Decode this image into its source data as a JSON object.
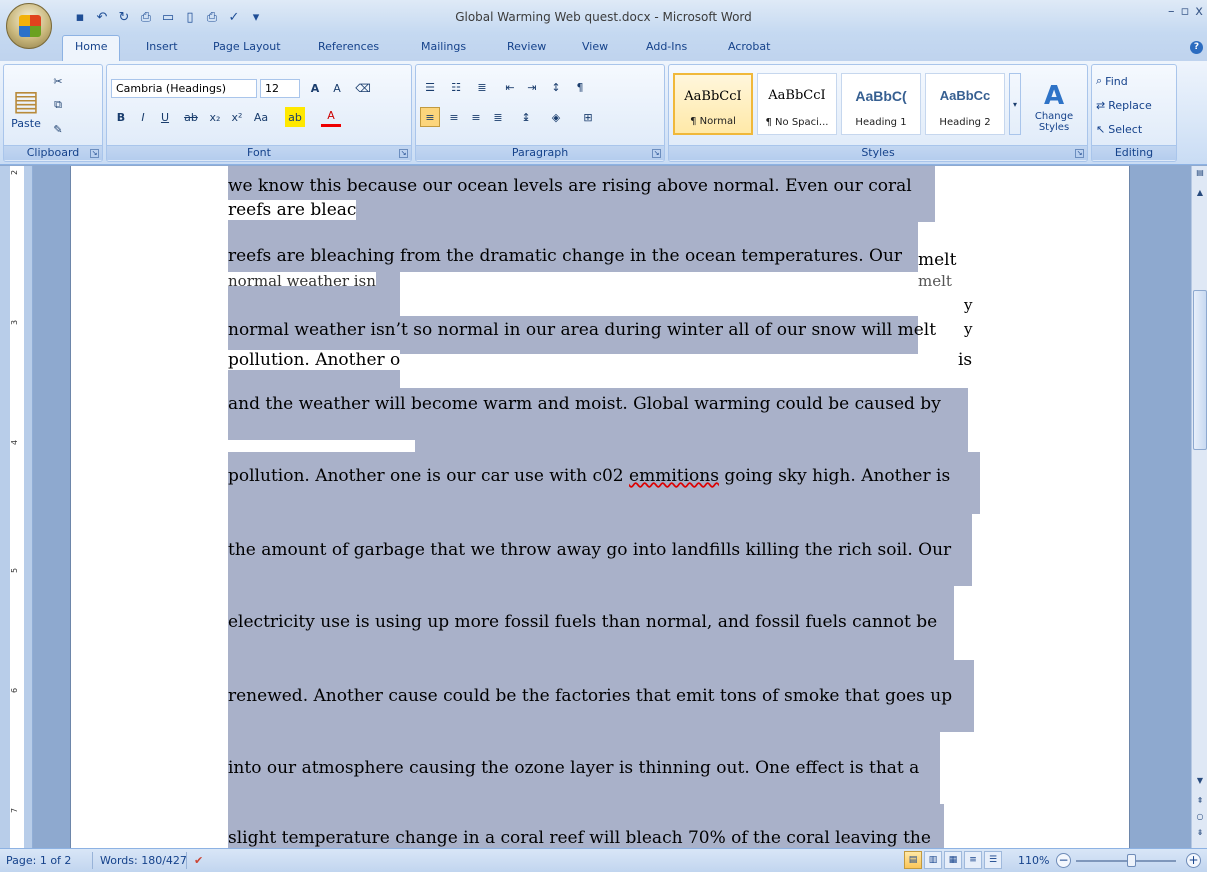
{
  "window": {
    "title": "Global Warming Web quest.docx - Microsoft Word",
    "controls": [
      "–",
      "▫",
      "x"
    ]
  },
  "quick_access": [
    "save-icon",
    "undo-icon",
    "redo-icon",
    "print-preview-icon",
    "open-icon",
    "new-icon",
    "print-icon",
    "spelling-icon"
  ],
  "tabs": [
    "Home",
    "Insert",
    "Page Layout",
    "References",
    "Mailings",
    "Review",
    "View",
    "Add-Ins",
    "Acrobat"
  ],
  "active_tab": "Home",
  "ribbon": {
    "clipboard": {
      "label": "Clipboard",
      "paste": "Paste"
    },
    "font": {
      "label": "Font",
      "font_name": "Cambria (Headings)",
      "font_size": "12"
    },
    "paragraph": {
      "label": "Paragraph"
    },
    "styles": {
      "label": "Styles",
      "tiles": [
        {
          "sample": "AaBbCcI",
          "name": "¶ Normal",
          "selected": true
        },
        {
          "sample": "AaBbCcI",
          "name": "¶ No Spaci...",
          "selected": false
        },
        {
          "sample": "AaBbC(",
          "name": "Heading 1",
          "selected": false
        },
        {
          "sample": "AaBbCc",
          "name": "Heading 2",
          "selected": false
        }
      ],
      "change_styles": "Change Styles"
    },
    "editing": {
      "label": "Editing",
      "find": "Find",
      "replace": "Replace",
      "select": "Select"
    }
  },
  "document": {
    "lines": [
      "we know this because our ocean levels are rising above normal.  Even our coral",
      "reefs are bleac",
      "reefs are bleaching from the dramatic change in the ocean temperatures.  Our",
      "normal weather isn",
      "normal weather isn’t so normal in our area during winter all of our snow will melt",
      "pollution.  Another o",
      "and the weather will become warm and moist.  Global warming could be caused by",
      "pollution.  Another one is our car use with c02",
      "emmitions",
      "going sky high.  Another is",
      "the amount of garbage that we throw away go into landfills killing the rich soil.  Our",
      "electricity use is using up more fossil fuels than normal, and fossil fuels cannot be",
      "renewed.  Another cause could be the factories that emit tons of smoke that goes up",
      "into our atmosphere causing the ozone layer is thinning out.  One effect is that a",
      "slight temperature change in a coral reef will bleach 70% of the coral leaving the"
    ],
    "fragments": {
      "melt1": "melt",
      "melt2": "melt",
      "is": "is",
      "y1": "y",
      "y2": "y"
    }
  },
  "ruler_numbers": [
    "2",
    "3",
    "4",
    "5",
    "6",
    "7"
  ],
  "status": {
    "page": "Page: 1 of 2",
    "words": "Words: 180/427",
    "zoom": "110%",
    "zoom_level": 0.55
  }
}
